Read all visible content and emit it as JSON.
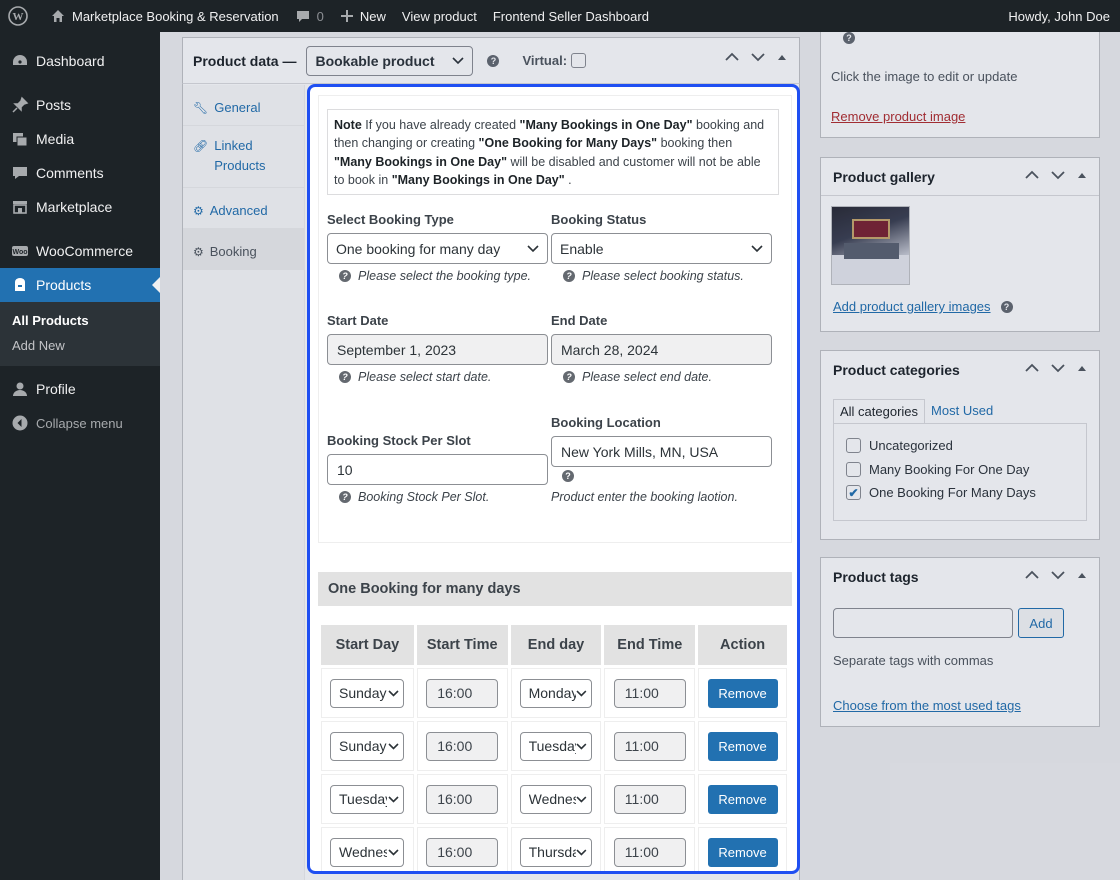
{
  "adminbar": {
    "site_name": "Marketplace Booking & Reservation",
    "comments_count": "0",
    "new_label": "New",
    "view_product": "View product",
    "frontend_dashboard": "Frontend Seller Dashboard",
    "howdy": "Howdy, John Doe"
  },
  "sidebar": {
    "items": [
      {
        "label": "Dashboard",
        "icon": "dashboard-icon"
      },
      {
        "label": "Posts",
        "icon": "pin-icon"
      },
      {
        "label": "Media",
        "icon": "media-icon"
      },
      {
        "label": "Comments",
        "icon": "comment-icon"
      },
      {
        "label": "Marketplace",
        "icon": "store-icon"
      },
      {
        "label": "WooCommerce",
        "icon": "woo-icon"
      },
      {
        "label": "Products",
        "icon": "archive-icon"
      },
      {
        "label": "Profile",
        "icon": "user-icon"
      },
      {
        "label": "Collapse menu",
        "icon": "collapse-icon"
      }
    ],
    "submenu": [
      "All Products",
      "Add New"
    ]
  },
  "product_data": {
    "title": "Product data —",
    "type_selected": "Bookable product",
    "virtual_label": "Virtual:",
    "tabs": [
      "General",
      "Linked Products",
      "Advanced",
      "Booking"
    ]
  },
  "booking": {
    "note": {
      "t1": "Note",
      "t2": " If you have already created ",
      "t3": "\"Many Bookings in One Day\"",
      "t4": " booking and then changing or creating ",
      "t5": "\"One Booking for Many Days\"",
      "t6": " booking then ",
      "t7": "\"Many Bookings in One Day\"",
      "t8": " will be disabled and customer will not be able to book in ",
      "t9": "\"Many Bookings in One Day\"",
      "t10": " ."
    },
    "booking_type_label": "Select Booking Type",
    "booking_type_value": "One booking for many day",
    "booking_type_hint": "Please select the booking type.",
    "booking_status_label": "Booking Status",
    "booking_status_value": "Enable",
    "booking_status_hint": "Please select booking status.",
    "start_date_label": "Start Date",
    "start_date_value": "September 1, 2023",
    "start_date_hint": "Please select start date.",
    "end_date_label": "End Date",
    "end_date_value": "March 28, 2024",
    "end_date_hint": "Please select end date.",
    "stock_label": "Booking Stock Per Slot",
    "stock_value": "10",
    "stock_hint": "Booking Stock Per Slot.",
    "location_label": "Booking Location",
    "location_value": "New York Mills, MN, USA",
    "location_hint": "Product enter the booking laotion.",
    "section_title": "One Booking for many days",
    "table_headers": [
      "Start Day",
      "Start Time",
      "End day",
      "End Time",
      "Action"
    ],
    "rows": [
      {
        "start_day": "Sunday",
        "start_time": "16:00",
        "end_day": "Monday",
        "end_time": "11:00",
        "action": "Remove"
      },
      {
        "start_day": "Sunday",
        "start_time": "16:00",
        "end_day": "Tuesday",
        "end_time": "11:00",
        "action": "Remove"
      },
      {
        "start_day": "Tuesday",
        "start_time": "16:00",
        "end_day": "Wednesday",
        "end_time": "11:00",
        "action": "Remove"
      },
      {
        "start_day": "Wednesday",
        "start_time": "16:00",
        "end_day": "Thursday",
        "end_time": "11:00",
        "action": "Remove"
      }
    ]
  },
  "right": {
    "image_hint": "Click the image to edit or update",
    "remove_image": "Remove product image",
    "gallery_title": "Product gallery",
    "add_gallery": "Add product gallery images",
    "categories_title": "Product categories",
    "cat_tab_all": "All categories",
    "cat_tab_used": "Most Used",
    "categories": [
      {
        "label": "Uncategorized",
        "checked": false
      },
      {
        "label": "Many Booking For One Day",
        "checked": false
      },
      {
        "label": "One Booking For Many Days",
        "checked": true
      }
    ],
    "tags_title": "Product tags",
    "tags_add": "Add",
    "tags_hint": "Separate tags with commas",
    "tags_choose": "Choose from the most used tags"
  }
}
